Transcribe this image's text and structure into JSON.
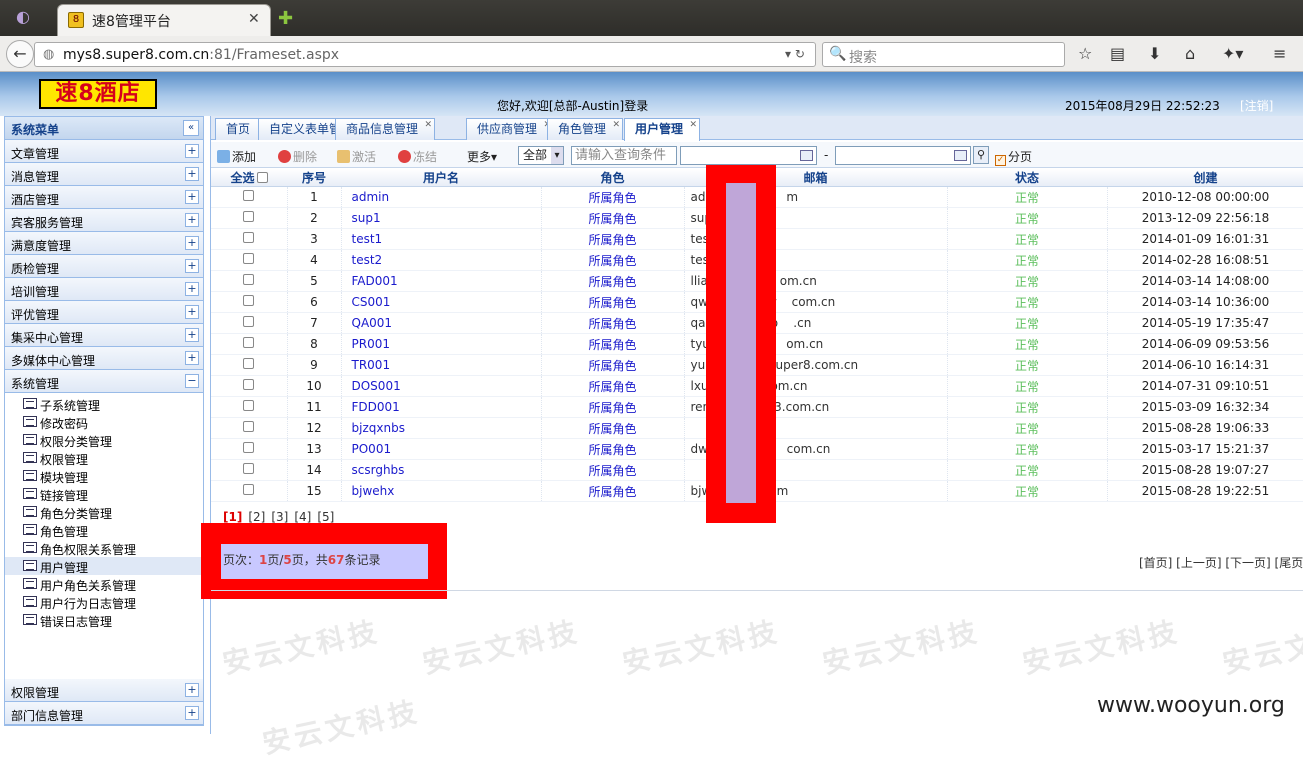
{
  "browser": {
    "tab_title": "速8管理平台",
    "url_host": "mys8.super8.com.cn",
    "url_rest": ":81/Frameset.aspx",
    "search_placeholder": "搜索"
  },
  "header": {
    "logo": "速8酒店",
    "welcome": "您好,欢迎[总部-Austin]登录",
    "datetime": "2015年08月29日 22:52:23",
    "logout": "[注销]"
  },
  "sidebar": {
    "title": "系统菜单",
    "menus": [
      "文章管理",
      "消息管理",
      "酒店管理",
      "宾客服务管理",
      "满意度管理",
      "质检管理",
      "培训管理",
      "评优管理",
      "集采中心管理",
      "多媒体中心管理",
      "系统管理"
    ],
    "sub_items": [
      "子系统管理",
      "修改密码",
      "权限分类管理",
      "权限管理",
      "模块管理",
      "链接管理",
      "角色分类管理",
      "角色管理",
      "角色权限关系管理",
      "用户管理",
      "用户角色关系管理",
      "用户行为日志管理",
      "错误日志管理"
    ],
    "selected_sub": "用户管理",
    "bottom_menus": [
      "权限管理",
      "部门信息管理"
    ]
  },
  "tabs": [
    "首页",
    "自定义表单管理",
    "商品信息管理",
    "供应商管理",
    "角色管理",
    "用户管理"
  ],
  "toolbar": {
    "add": "添加",
    "delete": "删除",
    "activate": "激活",
    "freeze": "冻结",
    "more": "更多",
    "select_value": "全部",
    "query_placeholder": "请输入查询条件",
    "dash": "-",
    "paging": "分页"
  },
  "columns": [
    "全选",
    "序号",
    "用户名",
    "角色",
    "邮箱",
    "状态",
    "创建"
  ],
  "rows": [
    {
      "no": "1",
      "name": "admin",
      "role": "所属角色",
      "mail": "adm    @163.    m",
      "status": "正常",
      "created": "2010-12-08 00:00:00"
    },
    {
      "no": "2",
      "name": "sup1",
      "role": "所属角色",
      "mail": "sup    @163.c",
      "status": "正常",
      "created": "2013-12-09 22:56:18"
    },
    {
      "no": "3",
      "name": "test1",
      "role": "所属角色",
      "mail": "test    163.c",
      "status": "正常",
      "created": "2014-01-09 16:01:31"
    },
    {
      "no": "4",
      "name": "test2",
      "role": "所属角色",
      "mail": "test    qq.co",
      "status": "正常",
      "created": "2014-02-28 16:08:51"
    },
    {
      "no": "5",
      "name": "FAD001",
      "role": "所属角色",
      "mail": "llian    super    om.cn",
      "status": "正常",
      "created": "2014-03-14 14:08:00"
    },
    {
      "no": "6",
      "name": "CS001",
      "role": "所属角色",
      "mail": "qwa    @super    com.cn",
      "status": "正常",
      "created": "2014-03-14 10:36:00"
    },
    {
      "no": "7",
      "name": "QA001",
      "role": "所属角色",
      "mail": "qa@    per8.co    .cn",
      "status": "正常",
      "created": "2014-05-19 17:35:47"
    },
    {
      "no": "8",
      "name": "PR001",
      "role": "所属角色",
      "mail": "tyu    @super    om.cn",
      "status": "正常",
      "created": "2014-06-09 09:53:56"
    },
    {
      "no": "9",
      "name": "TR001",
      "role": "所属角色",
      "mail": "yua    gwen    uper8.com.cn",
      "status": "正常",
      "created": "2014-06-10 16:14:31"
    },
    {
      "no": "10",
      "name": "DOS001",
      "role": "所属角色",
      "mail": "lxu    per8.    om.cn",
      "status": "正常",
      "created": "2014-07-31 09:10:51"
    },
    {
      "no": "11",
      "name": "FDD001",
      "role": "所属角色",
      "mail": "ren    g@su    3.com.cn",
      "status": "正常",
      "created": "2015-03-09 16:32:34"
    },
    {
      "no": "12",
      "name": "bjzqxnbs",
      "role": "所属角色",
      "mail": "",
      "status": "正常",
      "created": "2015-08-28 19:06:33"
    },
    {
      "no": "13",
      "name": "PO001",
      "role": "所属角色",
      "mail": "dwa    @supe    com.cn",
      "status": "正常",
      "created": "2015-03-17 15:21:37"
    },
    {
      "no": "14",
      "name": "scsrghbs",
      "role": "所属角色",
      "mail": "",
      "status": "正常",
      "created": "2015-08-28 19:07:27"
    },
    {
      "no": "15",
      "name": "bjwehx",
      "role": "所属角色",
      "mail": "bjw    @163    m",
      "status": "正常",
      "created": "2015-08-28 19:22:51"
    }
  ],
  "pager": {
    "pages": [
      "[1]",
      "[2]",
      "[3]",
      "[4]",
      "[5]"
    ],
    "info_prefix": "页次：",
    "info_cur": "1",
    "info_mid": "页/",
    "info_total": "5",
    "info_mid2": "页，共",
    "info_count": "67",
    "info_suffix": "条记录",
    "nav": "[首页] [上一页] [下一页] [尾页]"
  },
  "watermark": "安云文科技",
  "site": "www.wooyun.org",
  "colors": {
    "accent": "#15428b",
    "status_ok": "#5cbf5c",
    "link": "#1a1acc",
    "redact": "#ff0000"
  }
}
